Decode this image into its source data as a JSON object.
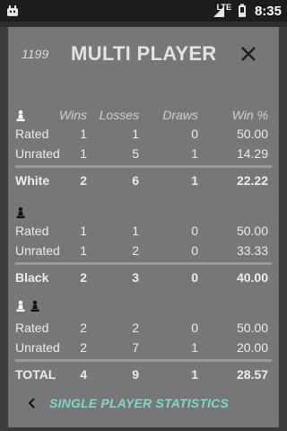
{
  "status_bar": {
    "time": "8:35",
    "network_label": "LTE"
  },
  "header": {
    "rating": "1199",
    "title": "MULTI PLAYER",
    "close_icon": "close-icon"
  },
  "table": {
    "columns": {
      "wins": "Wins",
      "losses": "Losses",
      "draws": "Draws",
      "win_pct": "Win %"
    },
    "sections": [
      {
        "piece": "white",
        "rows": [
          {
            "label": "Rated",
            "wins": "1",
            "losses": "1",
            "draws": "0",
            "win_pct": "50.00"
          },
          {
            "label": "Unrated",
            "wins": "1",
            "losses": "5",
            "draws": "1",
            "win_pct": "14.29"
          }
        ],
        "total": {
          "label": "White",
          "wins": "2",
          "losses": "6",
          "draws": "1",
          "win_pct": "22.22"
        }
      },
      {
        "piece": "black",
        "rows": [
          {
            "label": "Rated",
            "wins": "1",
            "losses": "1",
            "draws": "0",
            "win_pct": "50.00"
          },
          {
            "label": "Unrated",
            "wins": "1",
            "losses": "2",
            "draws": "0",
            "win_pct": "33.33"
          }
        ],
        "total": {
          "label": "Black",
          "wins": "2",
          "losses": "3",
          "draws": "0",
          "win_pct": "40.00"
        }
      },
      {
        "piece": "both",
        "rows": [
          {
            "label": "Rated",
            "wins": "2",
            "losses": "2",
            "draws": "0",
            "win_pct": "50.00"
          },
          {
            "label": "Unrated",
            "wins": "2",
            "losses": "7",
            "draws": "1",
            "win_pct": "20.00"
          }
        ],
        "total": {
          "label": "TOTAL",
          "wins": "4",
          "losses": "9",
          "draws": "1",
          "win_pct": "28.57"
        }
      }
    ]
  },
  "footer": {
    "label": "SINGLE PLAYER STATISTICS",
    "icon": "chevron-left-icon"
  },
  "colors": {
    "dialog_bg": "#777777",
    "accent": "#7fd8c8",
    "statusbar_bg": "#1d1d1d"
  }
}
